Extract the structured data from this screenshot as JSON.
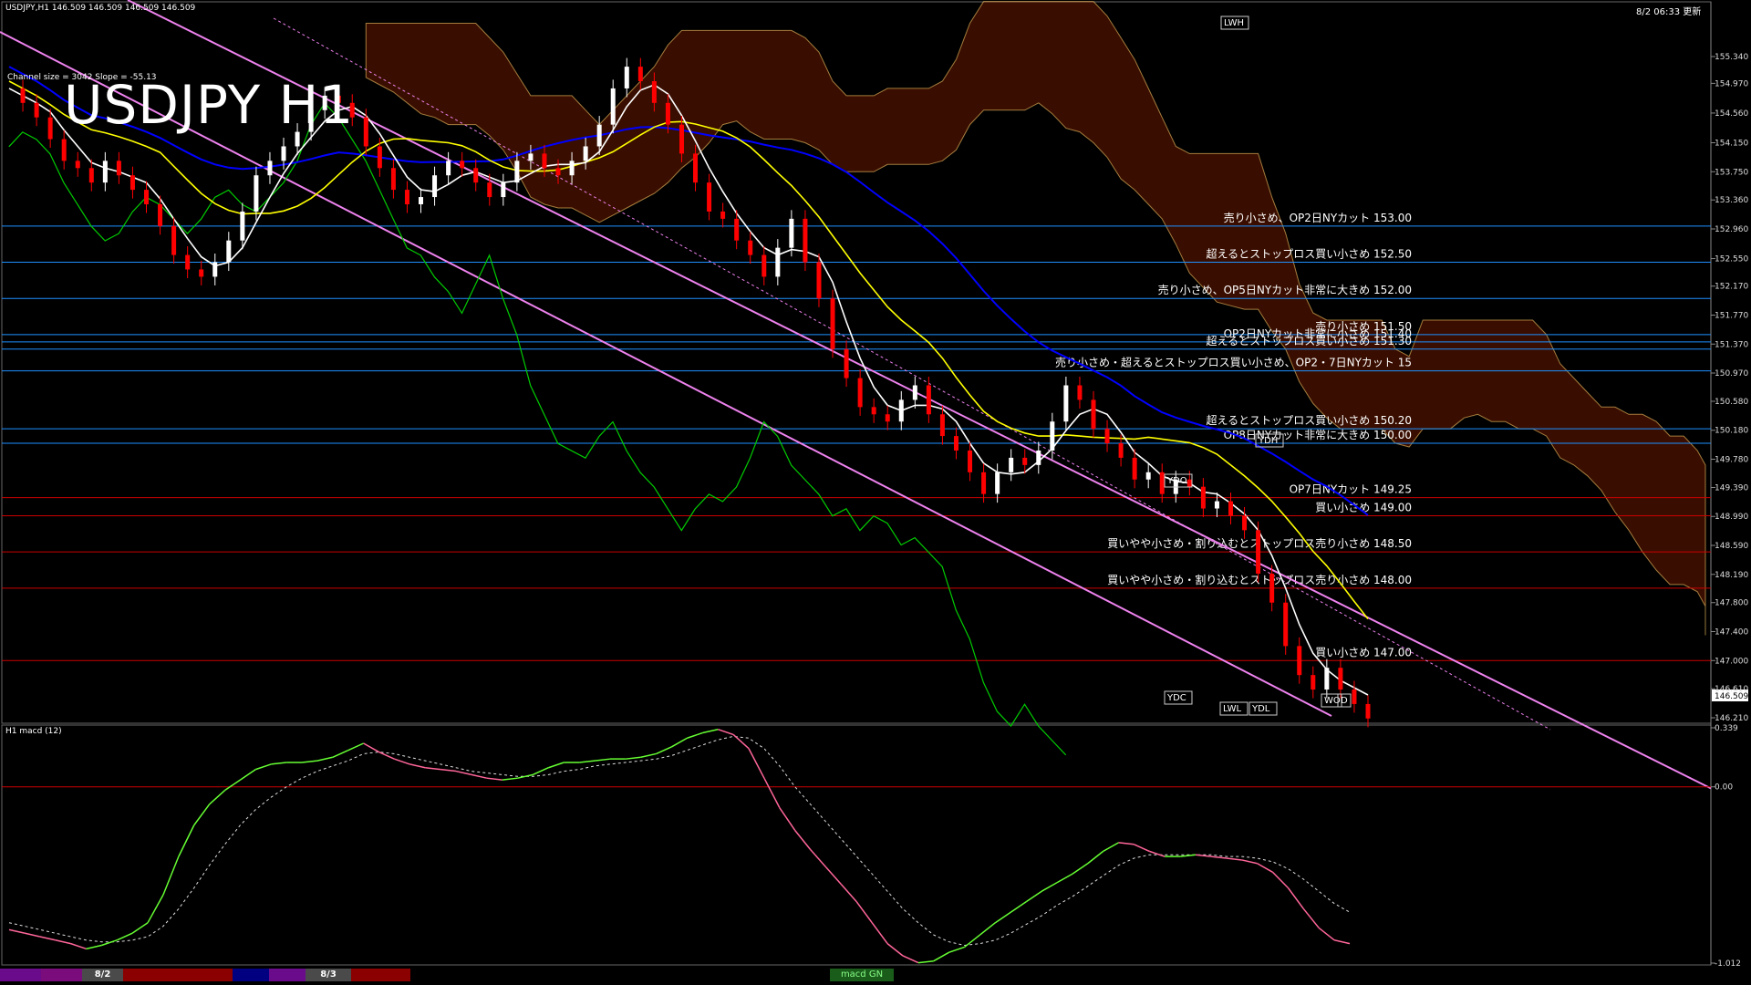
{
  "header": {
    "symbol_info": "USDJPY,H1  146.509 146.509 146.509 146.509",
    "channel_info": "Channel size = 3042  Slope = -55.13",
    "datetime": "8/2 06:33 更新",
    "big_title": "USDJPY H1",
    "macd_label": "H1  macd (12)"
  },
  "bottom_strip": {
    "labels": [
      "8/2",
      "8/3",
      "macd GN"
    ],
    "colors": [
      "#6a0b8c",
      "#7b0c7b",
      "#4a4a4a",
      "#8b0000",
      "#8b0000",
      "#000080",
      "#6a0b8c",
      "#4a4a4a",
      "#8b0000"
    ]
  },
  "colors": {
    "price_up": "#ffffff",
    "price_down": "#ff0000",
    "channel": "#ee82ee",
    "ma_white": "#ffffff",
    "ma_yellow": "#ffff00",
    "ma_blue": "#0000ff",
    "chikou": "#00cc00",
    "kumo": "#cc3300",
    "h_line_blue": "#1e90ff",
    "h_line_red": "#cc0000",
    "macd_up": "#66ff33",
    "macd_down": "#ff6699"
  },
  "chart_data": [
    {
      "type": "line",
      "title": "USDJPY H1",
      "y_ticks": [
        "155.340",
        "154.970",
        "154.560",
        "154.150",
        "153.750",
        "153.360",
        "152.960",
        "152.550",
        "152.170",
        "151.770",
        "151.370",
        "150.970",
        "150.580",
        "150.180",
        "149.780",
        "149.390",
        "148.990",
        "148.590",
        "148.190",
        "147.800",
        "147.400",
        "147.000",
        "146.610",
        "146.210"
      ],
      "current_price": "146.509",
      "ylim": [
        146.21,
        155.34
      ],
      "levels": [
        {
          "label": "売り小さめ、OP2日NYカット 153.00",
          "value": 153.0,
          "color": "#1e90ff"
        },
        {
          "label": "超えるとストップロス買い小さめ 152.50",
          "value": 152.5,
          "color": "#1e90ff"
        },
        {
          "label": "売り小さめ、OP5日NYカット非常に大きめ 152.00",
          "value": 152.0,
          "color": "#1e90ff"
        },
        {
          "label": "売り小さめ 151.50",
          "value": 151.5,
          "color": "#1e90ff"
        },
        {
          "label": "OP2日NYカット非常に小さめ 151.40",
          "value": 151.4,
          "color": "#1e90ff"
        },
        {
          "label": "超えるとストップロス買い小さめ 151.30",
          "value": 151.3,
          "color": "#1e90ff"
        },
        {
          "label": "売り小さめ・超えるとストップロス買い小さめ、OP2・7日NYカット 15",
          "value": 151.0,
          "color": "#1e90ff"
        },
        {
          "label": "超えるとストップロス買い小さめ 150.20",
          "value": 150.2,
          "color": "#1e90ff"
        },
        {
          "label": "OP8日NYカット非常に大きめ 150.00",
          "value": 150.0,
          "color": "#1e90ff"
        },
        {
          "label": "OP7日NYカット 149.25",
          "value": 149.25,
          "color": "#cc0000"
        },
        {
          "label": "買い小さめ 149.00",
          "value": 149.0,
          "color": "#cc0000"
        },
        {
          "label": "買いやや小さめ・割り込むとストップロス売り小さめ 148.50",
          "value": 148.5,
          "color": "#cc0000"
        },
        {
          "label": "買いやや小さめ・割り込むとストップロス売り小さめ 148.00",
          "value": 148.0,
          "color": "#cc0000"
        },
        {
          "label": "買い小さめ 147.00",
          "value": 147.0,
          "color": "#cc0000"
        }
      ],
      "markers": [
        "LWH",
        "YDH",
        "YDO",
        "YDC",
        "LWL",
        "YDL",
        "WO",
        "D"
      ],
      "series": [
        {
          "values": [
            154.9,
            154.7,
            154.5,
            154.2,
            153.9,
            153.8,
            153.6,
            153.9,
            153.7,
            153.5,
            153.3,
            153.0,
            152.6,
            152.4,
            152.3,
            152.5,
            152.8,
            153.2,
            153.7,
            153.9,
            154.1,
            154.3,
            154.6,
            154.8,
            154.7,
            154.5,
            154.1,
            153.8,
            153.5,
            153.3,
            153.4,
            153.7,
            153.9,
            153.8,
            153.6,
            153.4,
            153.6,
            153.9,
            154.0,
            153.8,
            153.7,
            153.9,
            154.1,
            154.4,
            154.9,
            155.2,
            155.0,
            154.7,
            154.4,
            154.0,
            153.6,
            153.2,
            153.1,
            152.8,
            152.6,
            152.3,
            152.7,
            153.1,
            152.5,
            152.0,
            151.3,
            150.9,
            150.5,
            150.4,
            150.3,
            150.6,
            150.8,
            150.4,
            150.1,
            149.9,
            149.6,
            149.3,
            149.6,
            149.8,
            149.7,
            149.9,
            150.3,
            150.8,
            150.6,
            150.2,
            150.0,
            149.8,
            149.5,
            149.6,
            149.3,
            149.5,
            149.4,
            149.1,
            149.2,
            149.0,
            148.8,
            148.2,
            147.8,
            147.2,
            146.8,
            146.6,
            146.9,
            146.6,
            146.4,
            146.2
          ]
        }
      ]
    },
    {
      "type": "line",
      "title": "H1  macd (12)",
      "y_ticks": [
        "0.339",
        "0.00",
        "-1.012"
      ],
      "ylim": [
        -1.012,
        0.339
      ],
      "series": [
        {
          "values": [
            -0.82,
            -0.84,
            -0.86,
            -0.88,
            -0.9,
            -0.93,
            -0.91,
            -0.88,
            -0.84,
            -0.78,
            -0.62,
            -0.4,
            -0.22,
            -0.1,
            -0.02,
            0.04,
            0.1,
            0.13,
            0.14,
            0.14,
            0.15,
            0.17,
            0.21,
            0.25,
            0.2,
            0.16,
            0.13,
            0.11,
            0.1,
            0.09,
            0.07,
            0.05,
            0.04,
            0.05,
            0.07,
            0.11,
            0.14,
            0.14,
            0.15,
            0.16,
            0.16,
            0.17,
            0.19,
            0.23,
            0.28,
            0.31,
            0.33,
            0.3,
            0.22,
            0.05,
            -0.12,
            -0.25,
            -0.36,
            -0.46,
            -0.56,
            -0.66,
            -0.78,
            -0.9,
            -0.97,
            -1.01,
            -1.0,
            -0.95,
            -0.92,
            -0.85,
            -0.78,
            -0.72,
            -0.66,
            -0.6,
            -0.55,
            -0.5,
            -0.44,
            -0.37,
            -0.32,
            -0.33,
            -0.37,
            -0.4,
            -0.4,
            -0.39,
            -0.4,
            -0.41,
            -0.42,
            -0.44,
            -0.49,
            -0.58,
            -0.7,
            -0.81,
            -0.88,
            -0.9
          ]
        },
        {
          "values": [
            -0.78,
            -0.8,
            -0.82,
            -0.84,
            -0.86,
            -0.88,
            -0.89,
            -0.89,
            -0.88,
            -0.86,
            -0.8,
            -0.7,
            -0.58,
            -0.45,
            -0.33,
            -0.22,
            -0.13,
            -0.06,
            0.0,
            0.05,
            0.09,
            0.12,
            0.15,
            0.19,
            0.2,
            0.19,
            0.17,
            0.15,
            0.13,
            0.11,
            0.09,
            0.08,
            0.07,
            0.06,
            0.06,
            0.07,
            0.09,
            0.1,
            0.12,
            0.13,
            0.14,
            0.15,
            0.16,
            0.18,
            0.21,
            0.24,
            0.27,
            0.29,
            0.28,
            0.22,
            0.12,
            0.0,
            -0.1,
            -0.2,
            -0.3,
            -0.4,
            -0.5,
            -0.6,
            -0.7,
            -0.78,
            -0.85,
            -0.89,
            -0.91,
            -0.9,
            -0.88,
            -0.84,
            -0.79,
            -0.74,
            -0.68,
            -0.63,
            -0.57,
            -0.51,
            -0.45,
            -0.41,
            -0.39,
            -0.39,
            -0.39,
            -0.39,
            -0.39,
            -0.4,
            -0.4,
            -0.41,
            -0.43,
            -0.47,
            -0.53,
            -0.6,
            -0.67,
            -0.72
          ]
        }
      ]
    }
  ]
}
